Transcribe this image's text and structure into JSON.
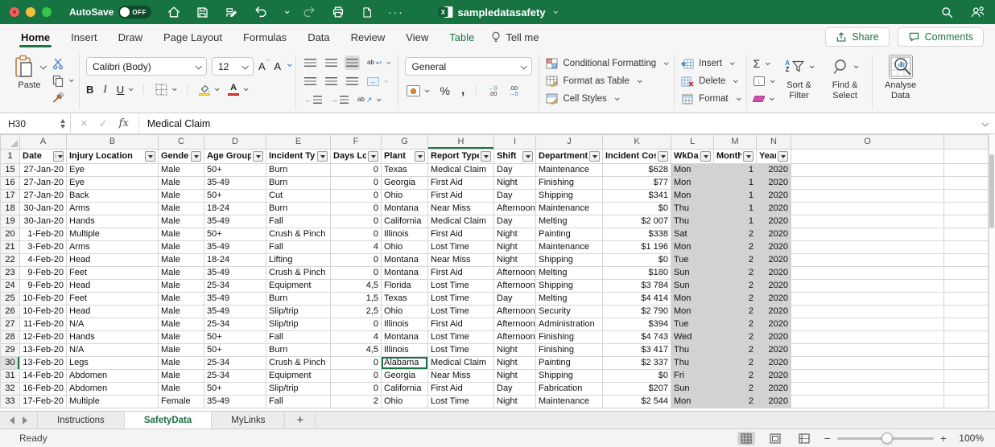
{
  "titlebar": {
    "autosave_label": "AutoSave",
    "autosave_state": "OFF",
    "doc_title": "sampledatasafety"
  },
  "tabs": {
    "items": [
      "Home",
      "Insert",
      "Draw",
      "Page Layout",
      "Formulas",
      "Data",
      "Review",
      "View",
      "Table"
    ],
    "active_tab": "Home",
    "contextual_tab": "Table",
    "tellme_label": "Tell me",
    "share_label": "Share",
    "comments_label": "Comments"
  },
  "ribbon": {
    "paste_label": "Paste",
    "font_name": "Calibri (Body)",
    "font_size": "12",
    "bold_label": "B",
    "italic_label": "I",
    "underline_label": "U",
    "number_format": "General",
    "conditional_formatting_label": "Conditional Formatting",
    "format_as_table_label": "Format as Table",
    "cell_styles_label": "Cell Styles",
    "insert_label": "Insert",
    "delete_label": "Delete",
    "format_label": "Format",
    "sort_filter_label": "Sort & Filter",
    "find_select_label": "Find & Select",
    "analyse_data_label": "Analyse Data"
  },
  "formula_bar": {
    "name_box": "H30",
    "fx_label": "fx",
    "value": "Medical Claim"
  },
  "grid": {
    "column_letters": [
      "A",
      "B",
      "C",
      "D",
      "E",
      "F",
      "G",
      "H",
      "I",
      "J",
      "K",
      "L",
      "M",
      "N",
      "O"
    ],
    "active_column": "H",
    "active_row": "30",
    "header_row_number": "1",
    "headers": [
      "Date",
      "Injury Location",
      "Gender",
      "Age Group",
      "Incident Type",
      "Days Lost",
      "Plant",
      "Report Type",
      "Shift",
      "Department",
      "Incident Cost",
      "WkDay",
      "Month",
      "Year"
    ],
    "rows": [
      {
        "n": "15",
        "cells": [
          "27-Jan-20",
          "Eye",
          "Male",
          "50+",
          "Burn",
          "0",
          "Texas",
          "Medical Claim",
          "Day",
          "Maintenance",
          "$628",
          "Mon",
          "1",
          "2020"
        ]
      },
      {
        "n": "16",
        "cells": [
          "27-Jan-20",
          "Eye",
          "Male",
          "35-49",
          "Burn",
          "0",
          "Georgia",
          "First Aid",
          "Night",
          "Finishing",
          "$77",
          "Mon",
          "1",
          "2020"
        ]
      },
      {
        "n": "17",
        "cells": [
          "27-Jan-20",
          "Back",
          "Male",
          "50+",
          "Cut",
          "0",
          "Ohio",
          "First Aid",
          "Day",
          "Shipping",
          "$341",
          "Mon",
          "1",
          "2020"
        ]
      },
      {
        "n": "18",
        "cells": [
          "30-Jan-20",
          "Arms",
          "Male",
          "18-24",
          "Burn",
          "0",
          "Montana",
          "Near Miss",
          "Afternoon",
          "Maintenance",
          "$0",
          "Thu",
          "1",
          "2020"
        ]
      },
      {
        "n": "19",
        "cells": [
          "30-Jan-20",
          "Hands",
          "Male",
          "35-49",
          "Fall",
          "0",
          "California",
          "Medical Claim",
          "Day",
          "Melting",
          "$2 007",
          "Thu",
          "1",
          "2020"
        ]
      },
      {
        "n": "20",
        "cells": [
          "1-Feb-20",
          "Multiple",
          "Male",
          "50+",
          "Crush & Pinch",
          "0",
          "Illinois",
          "First Aid",
          "Night",
          "Painting",
          "$338",
          "Sat",
          "2",
          "2020"
        ]
      },
      {
        "n": "21",
        "cells": [
          "3-Feb-20",
          "Arms",
          "Male",
          "35-49",
          "Fall",
          "4",
          "Ohio",
          "Lost Time",
          "Night",
          "Maintenance",
          "$1 196",
          "Mon",
          "2",
          "2020"
        ]
      },
      {
        "n": "22",
        "cells": [
          "4-Feb-20",
          "Head",
          "Male",
          "18-24",
          "Lifting",
          "0",
          "Montana",
          "Near Miss",
          "Night",
          "Shipping",
          "$0",
          "Tue",
          "2",
          "2020"
        ]
      },
      {
        "n": "23",
        "cells": [
          "9-Feb-20",
          "Feet",
          "Male",
          "35-49",
          "Crush & Pinch",
          "0",
          "Montana",
          "First Aid",
          "Afternoon",
          "Melting",
          "$180",
          "Sun",
          "2",
          "2020"
        ]
      },
      {
        "n": "24",
        "cells": [
          "9-Feb-20",
          "Head",
          "Male",
          "25-34",
          "Equipment",
          "4,5",
          "Florida",
          "Lost Time",
          "Afternoon",
          "Shipping",
          "$3 784",
          "Sun",
          "2",
          "2020"
        ]
      },
      {
        "n": "25",
        "cells": [
          "10-Feb-20",
          "Feet",
          "Male",
          "35-49",
          "Burn",
          "1,5",
          "Texas",
          "Lost Time",
          "Day",
          "Melting",
          "$4 414",
          "Mon",
          "2",
          "2020"
        ]
      },
      {
        "n": "26",
        "cells": [
          "10-Feb-20",
          "Head",
          "Male",
          "35-49",
          "Slip/trip",
          "2,5",
          "Ohio",
          "Lost Time",
          "Afternoon",
          "Security",
          "$2 790",
          "Mon",
          "2",
          "2020"
        ]
      },
      {
        "n": "27",
        "cells": [
          "11-Feb-20",
          "N/A",
          "Male",
          "25-34",
          "Slip/trip",
          "0",
          "Illinois",
          "First Aid",
          "Afternoon",
          "Administration",
          "$394",
          "Tue",
          "2",
          "2020"
        ]
      },
      {
        "n": "28",
        "cells": [
          "12-Feb-20",
          "Hands",
          "Male",
          "50+",
          "Fall",
          "4",
          "Montana",
          "Lost Time",
          "Afternoon",
          "Finishing",
          "$4 743",
          "Wed",
          "2",
          "2020"
        ]
      },
      {
        "n": "29",
        "cells": [
          "13-Feb-20",
          "N/A",
          "Male",
          "50+",
          "Burn",
          "4,5",
          "Illinois",
          "Lost Time",
          "Night",
          "Finishing",
          "$3 417",
          "Thu",
          "2",
          "2020"
        ]
      },
      {
        "n": "30",
        "cells": [
          "13-Feb-20",
          "Legs",
          "Male",
          "25-34",
          "Crush & Pinch",
          "0",
          "Alabama",
          "Medical Claim",
          "Night",
          "Painting",
          "$2 337",
          "Thu",
          "2",
          "2020"
        ]
      },
      {
        "n": "31",
        "cells": [
          "14-Feb-20",
          "Abdomen",
          "Male",
          "25-34",
          "Equipment",
          "0",
          "Georgia",
          "Near Miss",
          "Night",
          "Shipping",
          "$0",
          "Fri",
          "2",
          "2020"
        ]
      },
      {
        "n": "32",
        "cells": [
          "16-Feb-20",
          "Abdomen",
          "Male",
          "50+",
          "Slip/trip",
          "0",
          "California",
          "First Aid",
          "Day",
          "Fabrication",
          "$207",
          "Sun",
          "2",
          "2020"
        ]
      },
      {
        "n": "33",
        "cells": [
          "17-Feb-20",
          "Multiple",
          "Female",
          "35-49",
          "Fall",
          "2",
          "Ohio",
          "Lost Time",
          "Night",
          "Maintenance",
          "$2 544",
          "Mon",
          "2",
          "2020"
        ]
      }
    ]
  },
  "sheet_bar": {
    "tabs": [
      "Instructions",
      "SafetyData",
      "MyLinks"
    ],
    "active_tab": "SafetyData",
    "add_label": "+"
  },
  "status_bar": {
    "ready_label": "Ready",
    "zoom_value": "100%"
  }
}
